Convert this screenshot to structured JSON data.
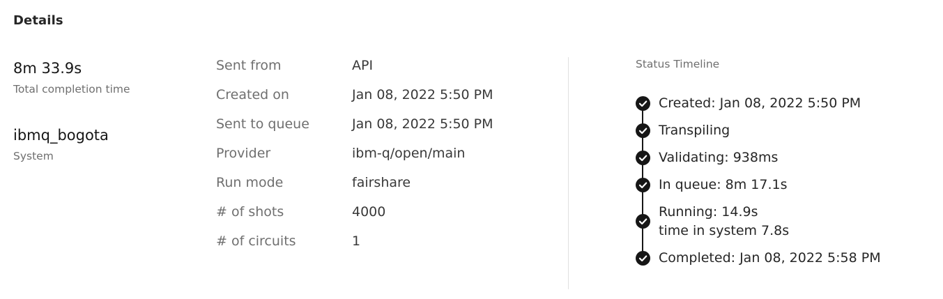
{
  "header": {
    "title": "Details"
  },
  "summary": {
    "completion_value": "8m 33.9s",
    "completion_label": "Total completion time",
    "system_value": "ibmq_bogota",
    "system_label": "System"
  },
  "properties": [
    {
      "label": "Sent from",
      "value": "API"
    },
    {
      "label": "Created on",
      "value": "Jan 08, 2022 5:50 PM"
    },
    {
      "label": "Sent to queue",
      "value": "Jan 08, 2022 5:50 PM"
    },
    {
      "label": "Provider",
      "value": "ibm-q/open/main"
    },
    {
      "label": "Run mode",
      "value": "fairshare"
    },
    {
      "label": "# of shots",
      "value": "4000"
    },
    {
      "label": "# of circuits",
      "value": "1"
    }
  ],
  "timeline": {
    "title": "Status Timeline",
    "steps": [
      {
        "text": "Created: Jan 08, 2022 5:50 PM",
        "icon": "checkmark-filled-icon"
      },
      {
        "text": "Transpiling",
        "icon": "checkmark-filled-icon"
      },
      {
        "text": "Validating: 938ms",
        "icon": "checkmark-filled-icon"
      },
      {
        "text": "In queue: 8m 17.1s",
        "icon": "checkmark-filled-icon"
      },
      {
        "text": "Running: 14.9s",
        "subtext": "time in system 7.8s",
        "icon": "checkmark-filled-icon"
      },
      {
        "text": "Completed: Jan 08, 2022 5:58 PM",
        "icon": "checkmark-filled-icon"
      }
    ]
  },
  "colors": {
    "text_primary": "#161616",
    "text_secondary": "#6f6f6f",
    "divider": "#e0e0e0",
    "timeline_icon": "#161616"
  }
}
